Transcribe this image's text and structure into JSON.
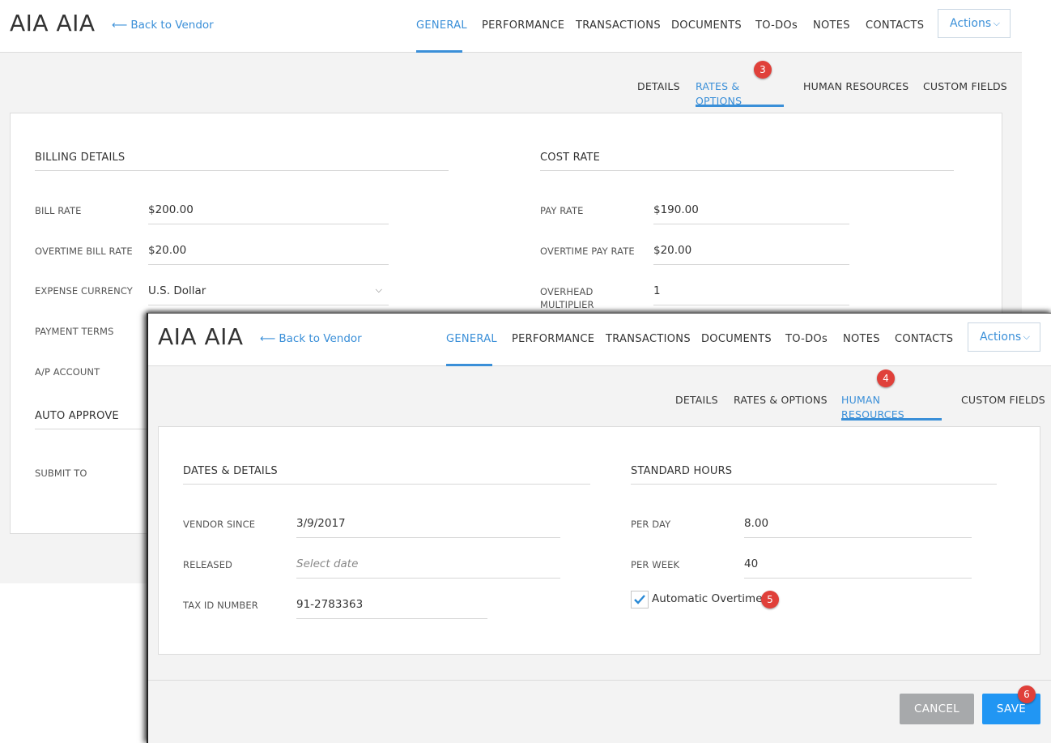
{
  "back": {
    "title": "AIA AIA",
    "back_link": "Back to Vendor",
    "nav": [
      "GENERAL",
      "PERFORMANCE",
      "TRANSACTIONS",
      "DOCUMENTS",
      "TO-DOs",
      "NOTES",
      "CONTACTS"
    ],
    "actions_label": "Actions",
    "subtabs": [
      "DETAILS",
      "RATES & OPTIONS",
      "HUMAN RESOURCES",
      "CUSTOM FIELDS"
    ],
    "step_badge": "3",
    "billing": {
      "heading": "BILLING DETAILS",
      "bill_rate_label": "BILL RATE",
      "bill_rate": "$200.00",
      "ot_bill_rate_label": "OVERTIME BILL RATE",
      "ot_bill_rate": "$20.00",
      "expense_currency_label": "EXPENSE CURRENCY",
      "expense_currency": "U.S. Dollar",
      "payment_terms_label": "PAYMENT TERMS",
      "ap_account_label": "A/P ACCOUNT"
    },
    "auto_approve": {
      "heading": "AUTO APPROVE",
      "submit_to_label": "SUBMIT TO"
    },
    "cost": {
      "heading": "COST RATE",
      "pay_rate_label": "PAY RATE",
      "pay_rate": "$190.00",
      "ot_pay_rate_label": "OVERTIME PAY RATE",
      "ot_pay_rate": "$20.00",
      "overhead_label_line1": "OVERHEAD",
      "overhead_label_line2": "MULTIPLIER",
      "overhead": "1"
    }
  },
  "front": {
    "title": "AIA AIA",
    "back_link": "Back to Vendor",
    "nav": [
      "GENERAL",
      "PERFORMANCE",
      "TRANSACTIONS",
      "DOCUMENTS",
      "TO-DOs",
      "NOTES",
      "CONTACTS"
    ],
    "actions_label": "Actions",
    "subtabs": [
      "DETAILS",
      "RATES & OPTIONS",
      "HUMAN RESOURCES",
      "CUSTOM FIELDS"
    ],
    "step_badge": "4",
    "dates": {
      "heading": "DATES & DETAILS",
      "vendor_since_label": "VENDOR SINCE",
      "vendor_since": "3/9/2017",
      "released_label": "RELEASED",
      "released_placeholder": "Select date",
      "tax_id_label": "TAX ID NUMBER",
      "tax_id": "91-2783363"
    },
    "hours": {
      "heading": "STANDARD HOURS",
      "per_day_label": "PER DAY",
      "per_day": "8.00",
      "per_week_label": "PER WEEK",
      "per_week": "40",
      "auto_overtime_label": "Automatic Overtime",
      "auto_overtime_checked": true,
      "step_badge": "5"
    },
    "footer": {
      "cancel_label": "CANCEL",
      "save_label": "SAVE",
      "step_badge": "6"
    }
  },
  "colors": {
    "accent": "#3a8fd8",
    "save": "#2196f3",
    "cancel": "#a7a9ab",
    "badge": "#e0403a"
  }
}
